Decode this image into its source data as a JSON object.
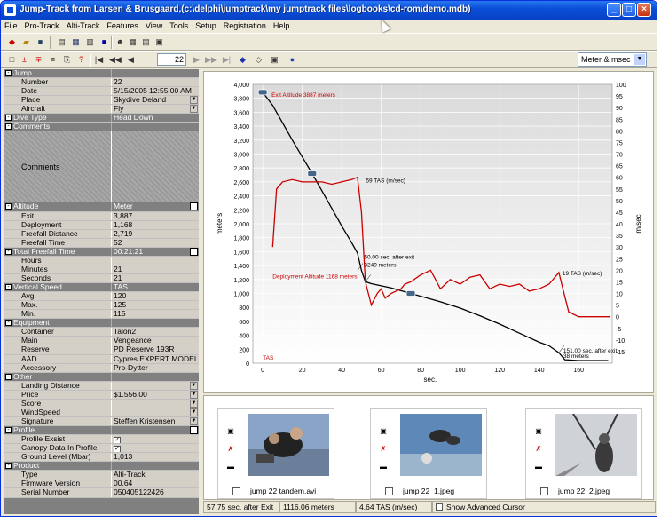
{
  "window": {
    "title": "Jump-Track from Larsen & Brusgaard,(c:\\delphi\\jumptrack\\my jumptrack files\\logbooks\\cd-rom\\demo.mdb)"
  },
  "menu": [
    "File",
    "Pro-Track",
    "Alti-Track",
    "Features",
    "View",
    "Tools",
    "Setup",
    "Registration",
    "Help"
  ],
  "toolbar": {
    "page": "22",
    "units": "Meter & msec"
  },
  "details": {
    "jump": {
      "header": "Jump",
      "number_label": "Number",
      "number": "22",
      "date_label": "Date",
      "date": "5/15/2005 12:55:00 AM",
      "place_label": "Place",
      "place": "Skydive Deland",
      "aircraft_label": "Aircraft",
      "aircraft": "Fly"
    },
    "dive_type": {
      "label": "Dive Type",
      "value": "Head Down"
    },
    "comments": {
      "header": "Comments",
      "label": "Comments"
    },
    "altitude": {
      "header": "Altitude",
      "unit": "Meter",
      "exit_label": "Exit",
      "exit": "3,887",
      "deployment_label": "Deployment",
      "deployment": "1,168",
      "freefall_distance_label": "Freefall Distance",
      "freefall_distance": "2,719",
      "freefall_time_label": "Freefall Time",
      "freefall_time": "52"
    },
    "total_freefall": {
      "header": "Total Freefall Time",
      "value": "00:21:21",
      "hours_label": "Hours",
      "hours": "",
      "minutes_label": "Minutes",
      "minutes": "21",
      "seconds_label": "Seconds",
      "seconds": "21"
    },
    "vertical_speed": {
      "header": "Vertical Speed",
      "unit": "TAS",
      "avg_label": "Avg.",
      "avg": "120",
      "max_label": "Max.",
      "max": "125",
      "min_label": "Min.",
      "min": "115"
    },
    "equipment": {
      "header": "Equipment",
      "container_label": "Container",
      "container": "Talon2",
      "main_label": "Main",
      "main": "Vengeance",
      "reserve_label": "Reserve",
      "reserve": "PD Reserve 193R",
      "aad_label": "AAD",
      "aad": "Cypres EXPERT MODEL S...",
      "accessory_label": "Accessory",
      "accessory": "Pro-Dytter"
    },
    "other": {
      "header": "Other",
      "landing_label": "Landing Distance",
      "landing": "",
      "price_label": "Price",
      "price": "$1.556.00",
      "score_label": "Score",
      "score": "",
      "wind_label": "WindSpeed",
      "wind": "",
      "signature_label": "Signature",
      "signature": "Steffen Kristensen"
    },
    "profile": {
      "header": "Profile",
      "exsist_label": "Profile Exsist",
      "canopy_label": "Canopy Data In Profile",
      "ground_label": "Ground Level (Mbar)",
      "ground": "1,013"
    },
    "product": {
      "header": "Product",
      "type_label": "Type",
      "type": "Alti-Track",
      "firmware_label": "Firmware Version",
      "firmware": "00.64",
      "serial_label": "Serial Number",
      "serial": "050405122426"
    }
  },
  "chart_data": {
    "type": "line",
    "xlabel": "sec.",
    "ylabel": "meters",
    "y2label": "m/sec",
    "xlim": [
      -5,
      177
    ],
    "ylim": [
      0,
      4000
    ],
    "y2lim": [
      -20,
      100
    ],
    "xticks": [
      0,
      20,
      40,
      60,
      80,
      100,
      120,
      140,
      160
    ],
    "yticks": [
      0,
      200,
      400,
      600,
      800,
      1000,
      1200,
      1400,
      1600,
      1800,
      2000,
      2200,
      2400,
      2600,
      2800,
      3000,
      3200,
      3400,
      3600,
      3800,
      4000
    ],
    "y2ticks": [
      -15,
      -10,
      -5,
      0,
      5,
      10,
      15,
      20,
      25,
      30,
      35,
      40,
      45,
      50,
      55,
      60,
      65,
      70,
      75,
      80,
      85,
      90,
      95,
      100
    ],
    "series": [
      {
        "name": "altitude",
        "color": "#000000",
        "axis": "left",
        "x": [
          0,
          5,
          10,
          15,
          20,
          25,
          30,
          35,
          40,
          45,
          48,
          50,
          52,
          55,
          60,
          65,
          70,
          75,
          80,
          85,
          90,
          100,
          110,
          120,
          130,
          140,
          145,
          150,
          153,
          160,
          170,
          175
        ],
        "y": [
          3887,
          3700,
          3450,
          3200,
          2960,
          2720,
          2470,
          2220,
          1970,
          1730,
          1580,
          1330,
          1168,
          1140,
          1110,
          1080,
          1040,
          1000,
          960,
          920,
          880,
          790,
          680,
          560,
          430,
          300,
          250,
          150,
          50,
          38,
          38,
          38
        ]
      },
      {
        "name": "TAS",
        "color": "#cc0000",
        "axis": "right",
        "x": [
          5,
          7,
          10,
          15,
          20,
          25,
          30,
          35,
          40,
          45,
          48,
          50,
          52,
          55,
          58,
          60,
          62,
          65,
          70,
          72,
          75,
          80,
          85,
          90,
          95,
          100,
          105,
          110,
          115,
          120,
          125,
          130,
          135,
          140,
          145,
          148,
          150,
          152,
          155,
          160,
          170,
          176
        ],
        "y": [
          30,
          55,
          58,
          59,
          58,
          58,
          58,
          57,
          58,
          59,
          60,
          45,
          15,
          5,
          10,
          12,
          8,
          10,
          12,
          14,
          15,
          18,
          20,
          12,
          16,
          14,
          17,
          18,
          12,
          14,
          13,
          14,
          11,
          12,
          14,
          17,
          19,
          12,
          2,
          0,
          0,
          0
        ]
      }
    ],
    "annotations": [
      "Exit Altitude 3887 meters",
      "59 TAS (m/sec)",
      "50.00 sec. after exit",
      "3249 meters",
      "Deployment Altitude 1168 meters",
      "19 TAS (m/sec)",
      "151.00 sec. after exit",
      "38 meters",
      "TAS"
    ]
  },
  "media": [
    {
      "file": "jump 22 tandem.avi"
    },
    {
      "file": "jump 22_1.jpeg"
    },
    {
      "file": "jump 22_2.jpeg"
    }
  ],
  "status": {
    "time": "57.75 sec. after Exit",
    "altitude": "1116.06 meters",
    "speed": "4.64 TAS (m/sec)",
    "cursor_label": "Show Advanced Cursor"
  }
}
